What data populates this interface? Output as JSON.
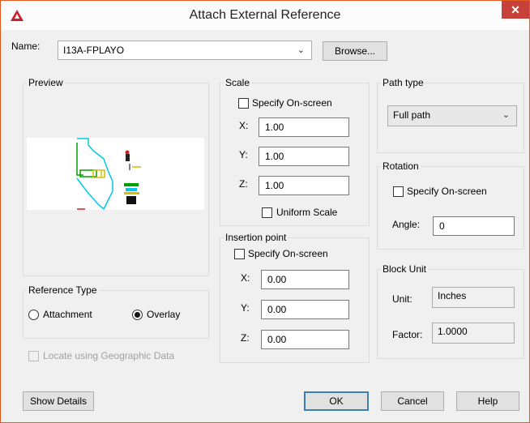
{
  "window": {
    "title": "Attach External Reference",
    "close_glyph": "✕"
  },
  "name_row": {
    "label": "Name:",
    "value": "I13A-FPLAYO",
    "browse_label": "Browse..."
  },
  "preview": {
    "label": "Preview"
  },
  "scale": {
    "label": "Scale",
    "specify_on_screen": "Specify On-screen",
    "x_label": "X:",
    "x_value": "1.00",
    "y_label": "Y:",
    "y_value": "1.00",
    "z_label": "Z:",
    "z_value": "1.00",
    "uniform_scale": "Uniform Scale"
  },
  "insertion": {
    "label": "Insertion point",
    "specify_on_screen": "Specify On-screen",
    "x_label": "X:",
    "x_value": "0.00",
    "y_label": "Y:",
    "y_value": "0.00",
    "z_label": "Z:",
    "z_value": "0.00"
  },
  "path_type": {
    "label": "Path type",
    "value": "Full path"
  },
  "rotation": {
    "label": "Rotation",
    "specify_on_screen": "Specify On-screen",
    "angle_label": "Angle:",
    "angle_value": "0"
  },
  "block_unit": {
    "label": "Block Unit",
    "unit_label": "Unit:",
    "unit_value": "Inches",
    "factor_label": "Factor:",
    "factor_value": "1.0000"
  },
  "reference_type": {
    "label": "Reference Type",
    "attachment": "Attachment",
    "overlay": "Overlay",
    "selected": "Overlay"
  },
  "locate_geo": "Locate using Geographic Data",
  "buttons": {
    "show_details": "Show Details",
    "ok": "OK",
    "cancel": "Cancel",
    "help": "Help"
  },
  "colors": {
    "accent_border": "#e25a1c",
    "close_bg": "#c7413b",
    "app_icon": "#c8202f"
  }
}
